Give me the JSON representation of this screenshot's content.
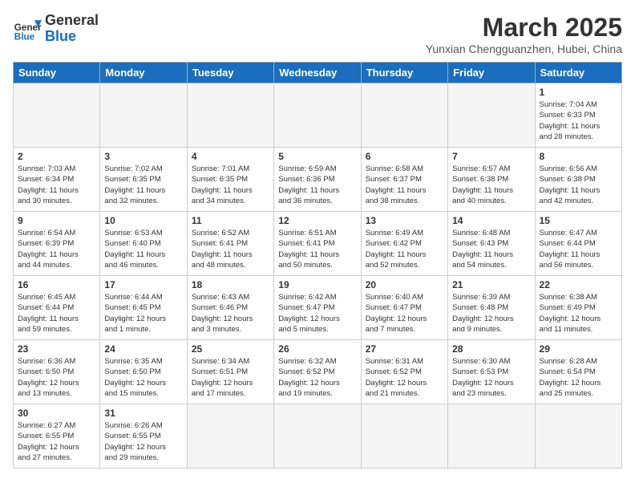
{
  "header": {
    "logo_general": "General",
    "logo_blue": "Blue",
    "month_year": "March 2025",
    "location": "Yunxian Chengguanzhen, Hubei, China"
  },
  "weekdays": [
    "Sunday",
    "Monday",
    "Tuesday",
    "Wednesday",
    "Thursday",
    "Friday",
    "Saturday"
  ],
  "weeks": [
    [
      {
        "day": "",
        "info": ""
      },
      {
        "day": "",
        "info": ""
      },
      {
        "day": "",
        "info": ""
      },
      {
        "day": "",
        "info": ""
      },
      {
        "day": "",
        "info": ""
      },
      {
        "day": "",
        "info": ""
      },
      {
        "day": "1",
        "info": "Sunrise: 7:04 AM\nSunset: 6:33 PM\nDaylight: 11 hours\nand 28 minutes."
      }
    ],
    [
      {
        "day": "2",
        "info": "Sunrise: 7:03 AM\nSunset: 6:34 PM\nDaylight: 11 hours\nand 30 minutes."
      },
      {
        "day": "3",
        "info": "Sunrise: 7:02 AM\nSunset: 6:35 PM\nDaylight: 11 hours\nand 32 minutes."
      },
      {
        "day": "4",
        "info": "Sunrise: 7:01 AM\nSunset: 6:35 PM\nDaylight: 11 hours\nand 34 minutes."
      },
      {
        "day": "5",
        "info": "Sunrise: 6:59 AM\nSunset: 6:36 PM\nDaylight: 11 hours\nand 36 minutes."
      },
      {
        "day": "6",
        "info": "Sunrise: 6:58 AM\nSunset: 6:37 PM\nDaylight: 11 hours\nand 38 minutes."
      },
      {
        "day": "7",
        "info": "Sunrise: 6:57 AM\nSunset: 6:38 PM\nDaylight: 11 hours\nand 40 minutes."
      },
      {
        "day": "8",
        "info": "Sunrise: 6:56 AM\nSunset: 6:38 PM\nDaylight: 11 hours\nand 42 minutes."
      }
    ],
    [
      {
        "day": "9",
        "info": "Sunrise: 6:54 AM\nSunset: 6:39 PM\nDaylight: 11 hours\nand 44 minutes."
      },
      {
        "day": "10",
        "info": "Sunrise: 6:53 AM\nSunset: 6:40 PM\nDaylight: 11 hours\nand 46 minutes."
      },
      {
        "day": "11",
        "info": "Sunrise: 6:52 AM\nSunset: 6:41 PM\nDaylight: 11 hours\nand 48 minutes."
      },
      {
        "day": "12",
        "info": "Sunrise: 6:51 AM\nSunset: 6:41 PM\nDaylight: 11 hours\nand 50 minutes."
      },
      {
        "day": "13",
        "info": "Sunrise: 6:49 AM\nSunset: 6:42 PM\nDaylight: 11 hours\nand 52 minutes."
      },
      {
        "day": "14",
        "info": "Sunrise: 6:48 AM\nSunset: 6:43 PM\nDaylight: 11 hours\nand 54 minutes."
      },
      {
        "day": "15",
        "info": "Sunrise: 6:47 AM\nSunset: 6:44 PM\nDaylight: 11 hours\nand 56 minutes."
      }
    ],
    [
      {
        "day": "16",
        "info": "Sunrise: 6:45 AM\nSunset: 6:44 PM\nDaylight: 11 hours\nand 59 minutes."
      },
      {
        "day": "17",
        "info": "Sunrise: 6:44 AM\nSunset: 6:45 PM\nDaylight: 12 hours\nand 1 minute."
      },
      {
        "day": "18",
        "info": "Sunrise: 6:43 AM\nSunset: 6:46 PM\nDaylight: 12 hours\nand 3 minutes."
      },
      {
        "day": "19",
        "info": "Sunrise: 6:42 AM\nSunset: 6:47 PM\nDaylight: 12 hours\nand 5 minutes."
      },
      {
        "day": "20",
        "info": "Sunrise: 6:40 AM\nSunset: 6:47 PM\nDaylight: 12 hours\nand 7 minutes."
      },
      {
        "day": "21",
        "info": "Sunrise: 6:39 AM\nSunset: 6:48 PM\nDaylight: 12 hours\nand 9 minutes."
      },
      {
        "day": "22",
        "info": "Sunrise: 6:38 AM\nSunset: 6:49 PM\nDaylight: 12 hours\nand 11 minutes."
      }
    ],
    [
      {
        "day": "23",
        "info": "Sunrise: 6:36 AM\nSunset: 6:50 PM\nDaylight: 12 hours\nand 13 minutes."
      },
      {
        "day": "24",
        "info": "Sunrise: 6:35 AM\nSunset: 6:50 PM\nDaylight: 12 hours\nand 15 minutes."
      },
      {
        "day": "25",
        "info": "Sunrise: 6:34 AM\nSunset: 6:51 PM\nDaylight: 12 hours\nand 17 minutes."
      },
      {
        "day": "26",
        "info": "Sunrise: 6:32 AM\nSunset: 6:52 PM\nDaylight: 12 hours\nand 19 minutes."
      },
      {
        "day": "27",
        "info": "Sunrise: 6:31 AM\nSunset: 6:52 PM\nDaylight: 12 hours\nand 21 minutes."
      },
      {
        "day": "28",
        "info": "Sunrise: 6:30 AM\nSunset: 6:53 PM\nDaylight: 12 hours\nand 23 minutes."
      },
      {
        "day": "29",
        "info": "Sunrise: 6:28 AM\nSunset: 6:54 PM\nDaylight: 12 hours\nand 25 minutes."
      }
    ],
    [
      {
        "day": "30",
        "info": "Sunrise: 6:27 AM\nSunset: 6:55 PM\nDaylight: 12 hours\nand 27 minutes."
      },
      {
        "day": "31",
        "info": "Sunrise: 6:26 AM\nSunset: 6:55 PM\nDaylight: 12 hours\nand 29 minutes."
      },
      {
        "day": "",
        "info": ""
      },
      {
        "day": "",
        "info": ""
      },
      {
        "day": "",
        "info": ""
      },
      {
        "day": "",
        "info": ""
      },
      {
        "day": "",
        "info": ""
      }
    ]
  ]
}
